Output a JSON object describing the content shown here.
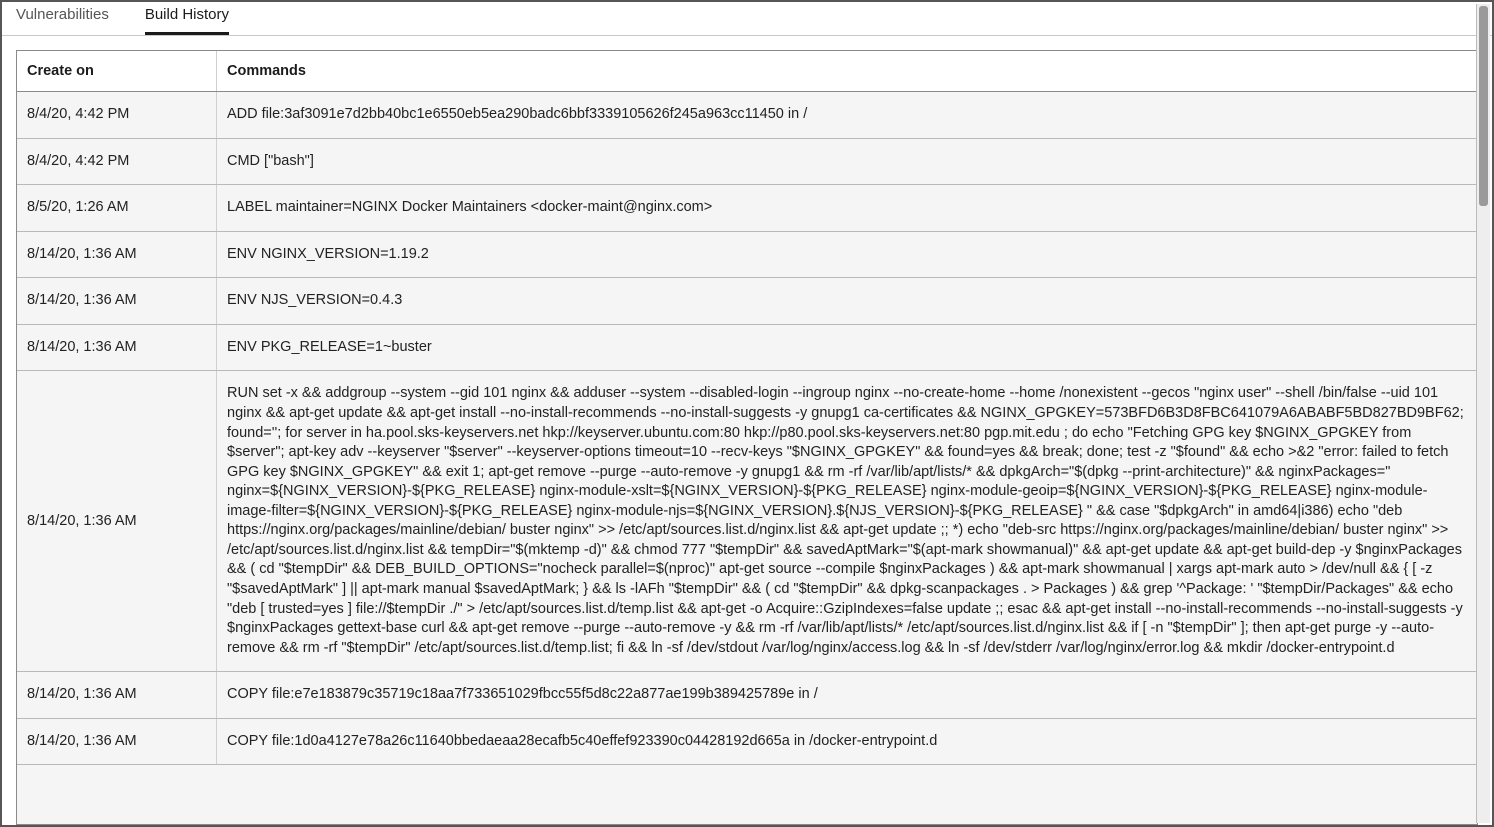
{
  "tabs": [
    {
      "label": "Vulnerabilities",
      "active": false
    },
    {
      "label": "Build History",
      "active": true
    }
  ],
  "table": {
    "headers": {
      "created_on": "Create on",
      "commands": "Commands"
    },
    "rows": [
      {
        "date": "8/4/20, 4:42 PM",
        "cmd": "ADD file:3af3091e7d2bb40bc1e6550eb5ea290badc6bbf3339105626f245a963cc11450 in /"
      },
      {
        "date": "8/4/20, 4:42 PM",
        "cmd": "CMD [\"bash\"]"
      },
      {
        "date": "8/5/20, 1:26 AM",
        "cmd": "LABEL maintainer=NGINX Docker Maintainers <docker-maint@nginx.com>"
      },
      {
        "date": "8/14/20, 1:36 AM",
        "cmd": "ENV NGINX_VERSION=1.19.2"
      },
      {
        "date": "8/14/20, 1:36 AM",
        "cmd": "ENV NJS_VERSION=0.4.3"
      },
      {
        "date": "8/14/20, 1:36 AM",
        "cmd": "ENV PKG_RELEASE=1~buster"
      },
      {
        "date": "8/14/20, 1:36 AM",
        "cmd": "RUN set -x && addgroup --system --gid 101 nginx && adduser --system --disabled-login --ingroup nginx --no-create-home --home /nonexistent --gecos \"nginx user\" --shell /bin/false --uid 101 nginx && apt-get update && apt-get install --no-install-recommends --no-install-suggests -y gnupg1 ca-certificates && NGINX_GPGKEY=573BFD6B3D8FBC641079A6ABABF5BD827BD9BF62; found=''; for server in ha.pool.sks-keyservers.net hkp://keyserver.ubuntu.com:80 hkp://p80.pool.sks-keyservers.net:80 pgp.mit.edu ; do echo \"Fetching GPG key $NGINX_GPGKEY from $server\"; apt-key adv --keyserver \"$server\" --keyserver-options timeout=10 --recv-keys \"$NGINX_GPGKEY\" && found=yes && break; done; test -z \"$found\" && echo >&2 \"error: failed to fetch GPG key $NGINX_GPGKEY\" && exit 1; apt-get remove --purge --auto-remove -y gnupg1 && rm -rf /var/lib/apt/lists/* && dpkgArch=\"$(dpkg --print-architecture)\" && nginxPackages=\" nginx=${NGINX_VERSION}-${PKG_RELEASE} nginx-module-xslt=${NGINX_VERSION}-${PKG_RELEASE} nginx-module-geoip=${NGINX_VERSION}-${PKG_RELEASE} nginx-module-image-filter=${NGINX_VERSION}-${PKG_RELEASE} nginx-module-njs=${NGINX_VERSION}.${NJS_VERSION}-${PKG_RELEASE} \" && case \"$dpkgArch\" in amd64|i386) echo \"deb https://nginx.org/packages/mainline/debian/ buster nginx\" >> /etc/apt/sources.list.d/nginx.list && apt-get update ;; *) echo \"deb-src https://nginx.org/packages/mainline/debian/ buster nginx\" >> /etc/apt/sources.list.d/nginx.list && tempDir=\"$(mktemp -d)\" && chmod 777 \"$tempDir\" && savedAptMark=\"$(apt-mark showmanual)\" && apt-get update && apt-get build-dep -y $nginxPackages && ( cd \"$tempDir\" && DEB_BUILD_OPTIONS=\"nocheck parallel=$(nproc)\" apt-get source --compile $nginxPackages ) && apt-mark showmanual | xargs apt-mark auto > /dev/null && { [ -z \"$savedAptMark\" ] || apt-mark manual $savedAptMark; } && ls -lAFh \"$tempDir\" && ( cd \"$tempDir\" && dpkg-scanpackages . > Packages ) && grep '^Package: ' \"$tempDir/Packages\" && echo \"deb [ trusted=yes ] file://$tempDir ./\" > /etc/apt/sources.list.d/temp.list && apt-get -o Acquire::GzipIndexes=false update ;; esac && apt-get install --no-install-recommends --no-install-suggests -y $nginxPackages gettext-base curl && apt-get remove --purge --auto-remove -y && rm -rf /var/lib/apt/lists/* /etc/apt/sources.list.d/nginx.list && if [ -n \"$tempDir\" ]; then apt-get purge -y --auto-remove && rm -rf \"$tempDir\" /etc/apt/sources.list.d/temp.list; fi && ln -sf /dev/stdout /var/log/nginx/access.log && ln -sf /dev/stderr /var/log/nginx/error.log && mkdir /docker-entrypoint.d"
      },
      {
        "date": "8/14/20, 1:36 AM",
        "cmd": "COPY file:e7e183879c35719c18aa7f733651029fbcc55f5d8c22a877ae199b389425789e in /"
      },
      {
        "date": "8/14/20, 1:36 AM",
        "cmd": "COPY file:1d0a4127e78a26c11640bbedaeaa28ecafb5c40effef923390c04428192d665a in /docker-entrypoint.d"
      }
    ]
  }
}
